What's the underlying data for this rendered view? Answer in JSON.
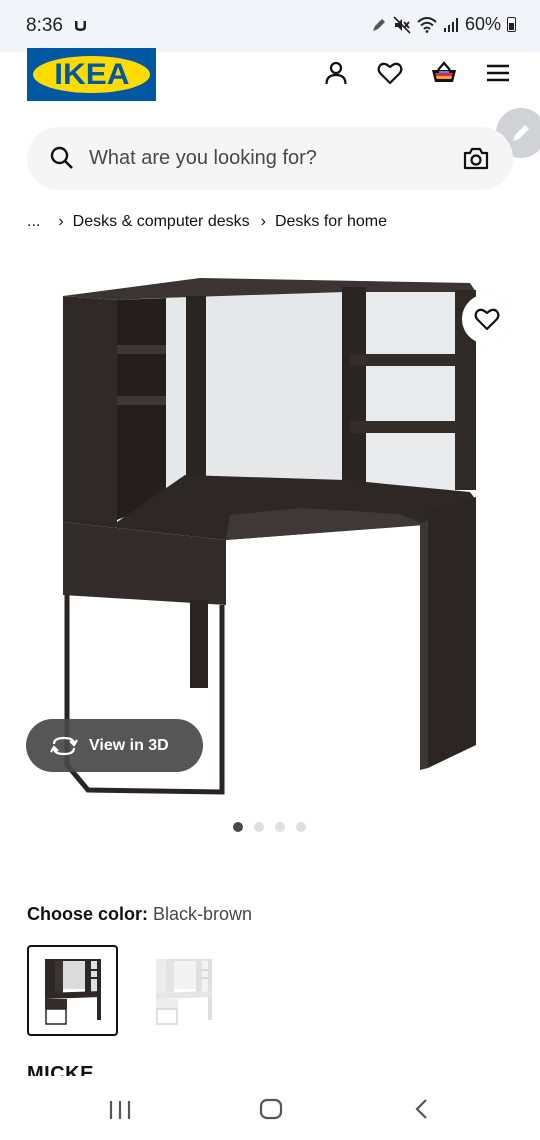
{
  "status_bar": {
    "time": "8:36",
    "battery": "60%",
    "icons": [
      "app-notification-icon",
      "pen-icon",
      "mute-icon",
      "wifi-icon",
      "signal-icon",
      "battery-icon"
    ]
  },
  "header": {
    "logo_text": "IKEA",
    "icons": [
      "account-icon",
      "heart-icon",
      "cart-icon",
      "menu-icon"
    ],
    "brand_colors": {
      "blue": "#0058a3",
      "yellow": "#ffdb00"
    }
  },
  "search": {
    "placeholder": "What are you looking for?"
  },
  "breadcrumb": {
    "ellipsis": "...",
    "items": [
      "Desks & computer desks",
      "Desks for home"
    ]
  },
  "gallery": {
    "view_3d_label": "View in 3D",
    "page_count": 4,
    "active_page": 1
  },
  "color_selector": {
    "label": "Choose color:",
    "value": "Black-brown",
    "options": [
      "Black-brown",
      "White"
    ],
    "selected": 0
  },
  "product": {
    "name": "MICKE"
  }
}
